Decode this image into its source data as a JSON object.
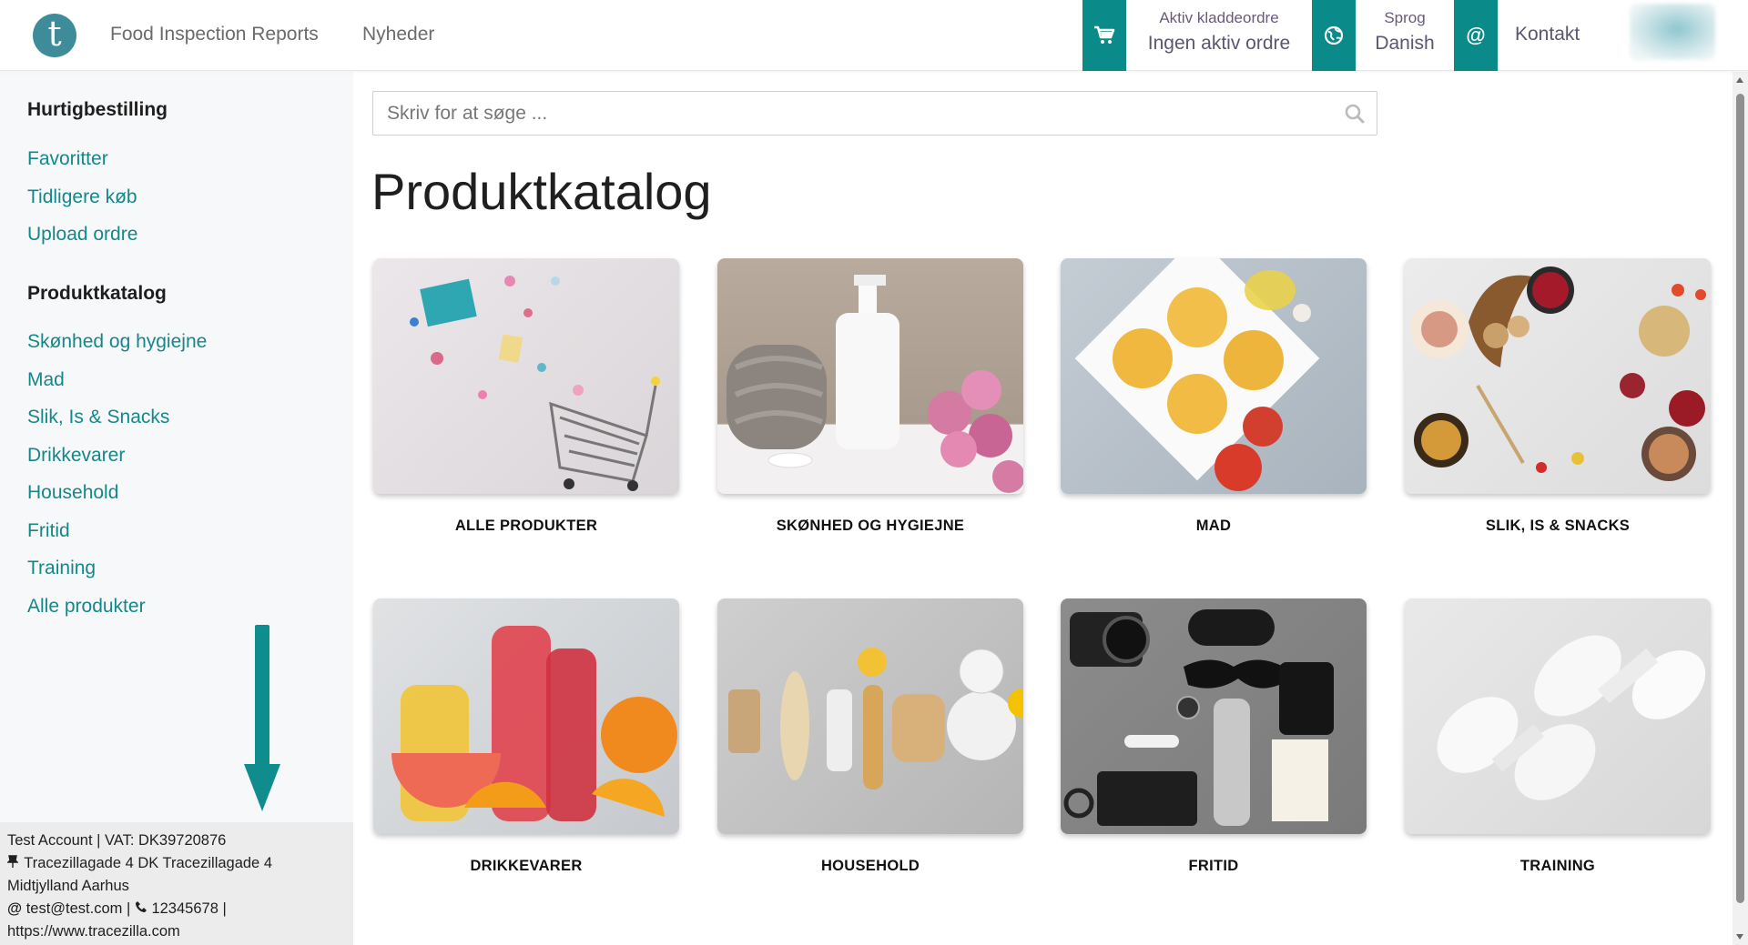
{
  "header": {
    "logo_letter": "t",
    "nav": [
      "Food Inspection Reports",
      "Nyheder"
    ],
    "order": {
      "label": "Aktiv kladdeordre",
      "value": "Ingen aktiv ordre",
      "icon": "cart-icon"
    },
    "language": {
      "label": "Sprog",
      "value": "Danish",
      "icon": "globe-icon"
    },
    "contact": {
      "label": "Kontakt",
      "icon": "at-icon"
    },
    "accent_color": "#0b8a8a"
  },
  "sidebar": {
    "quick_heading": "Hurtigbestilling",
    "quick_links": [
      "Favoritter",
      "Tidligere køb",
      "Upload ordre"
    ],
    "catalog_heading": "Produktkatalog",
    "catalog_links": [
      "Skønhed og hygiejne",
      "Mad",
      "Slik, Is & Snacks",
      "Drikkevarer",
      "Household",
      "Fritid",
      "Training",
      "Alle produkter"
    ],
    "footer": {
      "line1": "Test Account | VAT: DK39720876",
      "address": "Tracezillagade 4 DK Tracezillagade 4 Midtjylland Aarhus",
      "email": "test@test.com",
      "phone": "12345678",
      "website": "https://www.tracezilla.com"
    }
  },
  "search": {
    "placeholder": "Skriv for at søge ..."
  },
  "main": {
    "title": "Produktkatalog",
    "categories": [
      {
        "label": "ALLE PRODUKTER"
      },
      {
        "label": "SKØNHED OG HYGIEJNE"
      },
      {
        "label": "MAD"
      },
      {
        "label": "SLIK, IS & SNACKS"
      },
      {
        "label": "DRIKKEVARER"
      },
      {
        "label": "HOUSEHOLD"
      },
      {
        "label": "FRITID"
      },
      {
        "label": "TRAINING"
      }
    ]
  }
}
